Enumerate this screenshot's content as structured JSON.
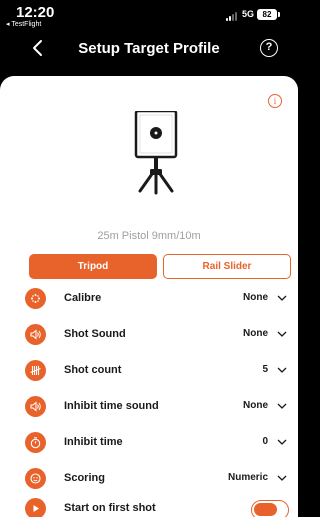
{
  "status_bar": {
    "time": "12:20",
    "back_app": "◂ TestFlight",
    "network": "5G",
    "battery": "82"
  },
  "nav": {
    "title": "Setup Target Profile",
    "help_glyph": "?"
  },
  "info_glyph": "i",
  "profile_name": "25m Pistol 9mm/10m",
  "mount_options": {
    "tripod": "Tripod",
    "rail_slider": "Rail Slider",
    "selected": "Tripod"
  },
  "settings": [
    {
      "label": "Calibre",
      "value": "None",
      "icon": "crosshair-dots-icon"
    },
    {
      "label": "Shot Sound",
      "value": "None",
      "icon": "speaker-icon"
    },
    {
      "label": "Shot count",
      "value": "5",
      "icon": "tally-marks-icon"
    },
    {
      "label": "Inhibit time sound",
      "value": "None",
      "icon": "speaker-icon"
    },
    {
      "label": "Inhibit time",
      "value": "0",
      "icon": "stopwatch-icon"
    },
    {
      "label": "Scoring",
      "value": "Numeric",
      "icon": "scoring-icon"
    },
    {
      "label": "Start on first shot",
      "value": "",
      "icon": "play-icon",
      "toggle_on": true
    }
  ],
  "colors": {
    "accent": "#e8632b",
    "background": "#000000",
    "sheet": "#ffffff",
    "muted_text": "#a0a0a0"
  }
}
